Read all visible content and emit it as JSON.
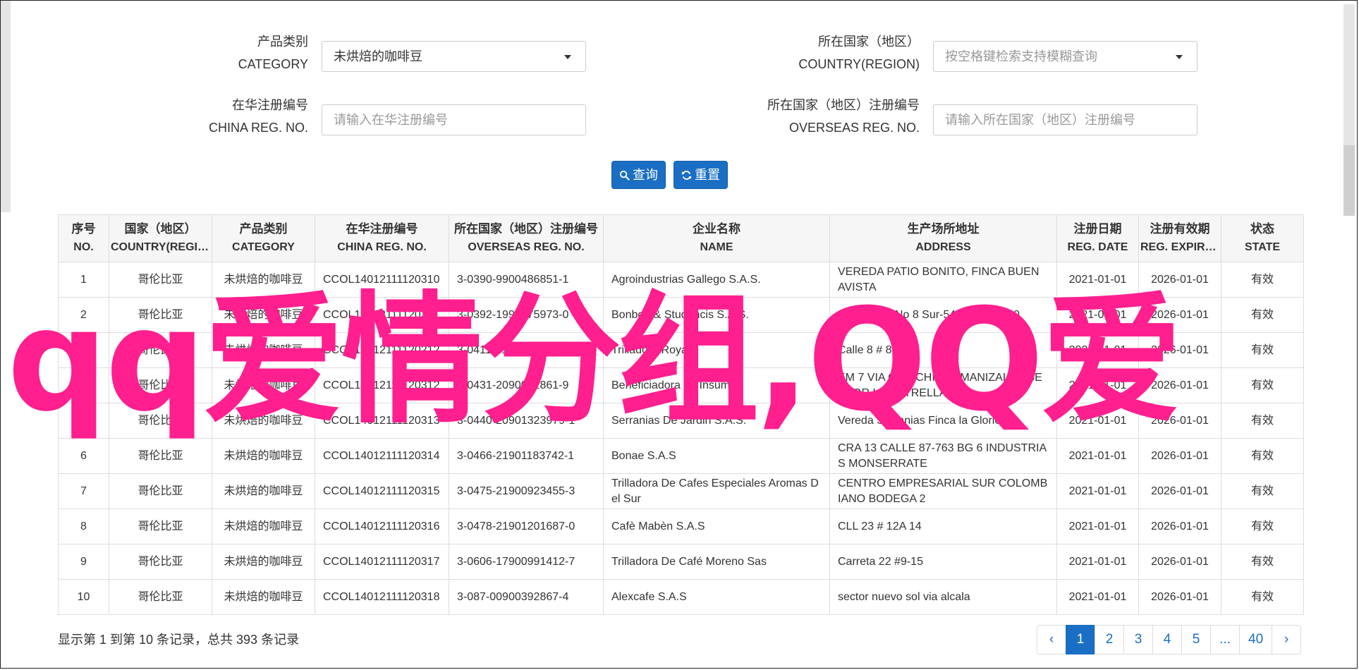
{
  "search": {
    "category_label_cn": "产品类别",
    "category_label_en": "CATEGORY",
    "category_value": "未烘焙的咖啡豆",
    "country_label_cn": "所在国家（地区）",
    "country_label_en": "COUNTRY(REGION)",
    "country_placeholder": "按空格键检索支持模糊查询",
    "china_reg_label_cn": "在华注册编号",
    "china_reg_label_en": "CHINA REG. NO.",
    "china_reg_placeholder": "请输入在华注册编号",
    "overseas_reg_label_cn": "所在国家（地区）注册编号",
    "overseas_reg_label_en": "OVERSEAS REG. NO.",
    "overseas_reg_placeholder": "请输入所在国家（地区）注册编号",
    "query_button": "查询",
    "reset_button": "重置"
  },
  "table": {
    "headers": [
      {
        "cn": "序号",
        "en": "NO."
      },
      {
        "cn": "国家（地区）",
        "en": "COUNTRY(REGIO..."
      },
      {
        "cn": "产品类别",
        "en": "CATEGORY"
      },
      {
        "cn": "在华注册编号",
        "en": "CHINA REG. NO."
      },
      {
        "cn": "所在国家（地区）注册编号",
        "en": "OVERSEAS REG. NO."
      },
      {
        "cn": "企业名称",
        "en": "NAME"
      },
      {
        "cn": "生产场所地址",
        "en": "ADDRESS"
      },
      {
        "cn": "注册日期",
        "en": "REG. DATE"
      },
      {
        "cn": "注册有效期",
        "en": "REG. EXPIRE ..."
      },
      {
        "cn": "状态",
        "en": "STATE"
      }
    ],
    "rows": [
      [
        "1",
        "哥伦比亚",
        "未烘焙的咖啡豆",
        "CCOL14012111120310",
        "3-0390-9900486851-1",
        "Agroindustrias Gallego S.A.S.",
        "VEREDA PATIO BONITO, FINCA BUEN AVISTA",
        "2021-01-01",
        "2026-01-01",
        "有效"
      ],
      [
        "2",
        "哥伦比亚",
        "未烘焙的咖啡豆",
        "CCOL14012111120311",
        "3-0392-1990075973-0",
        "Bonbori & Studancis S.A.S.",
        "Carrera 49 No 8 Sur-540 Bodega 20",
        "2021-01-01",
        "2026-01-01",
        "有效"
      ],
      [
        "3",
        "哥伦比亚",
        "未烘焙的咖啡豆",
        "CCOL14012111120212",
        "3-0411-2190009812-1",
        "Trilladora Royal",
        "Calle 8 # 8 - 28",
        "2021-01-01",
        "2026-01-01",
        "有效"
      ],
      [
        "4",
        "哥伦比亚",
        "未烘焙的咖啡豆",
        "CCOL14012111120312",
        "3-0431-2090021861-9",
        "Beneficiadora de Insumos",
        "KM 7 VIA CHINCHINA - MANIZALES SECTOR LA ESTRELLA",
        "2021-01-01",
        "2026-01-01",
        "有效"
      ],
      [
        "5",
        "哥伦比亚",
        "未烘焙的咖啡豆",
        "CCOL14012111120313",
        "3-0440-20901323979-1",
        "Serranias De Jardin S.A.S.",
        "Vereda Serranias Finca la Glorieta",
        "2021-01-01",
        "2026-01-01",
        "有效"
      ],
      [
        "6",
        "哥伦比亚",
        "未烘焙的咖啡豆",
        "CCOL14012111120314",
        "3-0466-21901183742-1",
        "Bonae S.A.S",
        "CRA 13 CALLE 87-763 BG 6 INDUSTRIAS MONSERRATE",
        "2021-01-01",
        "2026-01-01",
        "有效"
      ],
      [
        "7",
        "哥伦比亚",
        "未烘焙的咖啡豆",
        "CCOL14012111120315",
        "3-0475-21900923455-3",
        "Trilladora De Cafes Especiales Aromas Del Sur",
        "CENTRO EMPRESARIAL SUR COLOMBIANO BODEGA 2",
        "2021-01-01",
        "2026-01-01",
        "有效"
      ],
      [
        "8",
        "哥伦比亚",
        "未烘焙的咖啡豆",
        "CCOL14012111120316",
        "3-0478-21901201687-0",
        "Cafè Mabèn S.A.S",
        "CLL 23 # 12A 14",
        "2021-01-01",
        "2026-01-01",
        "有效"
      ],
      [
        "9",
        "哥伦比亚",
        "未烘焙的咖啡豆",
        "CCOL14012111120317",
        "3-0606-17900991412-7",
        "Trilladora De Café Moreno Sas",
        "Carreta 22 #9-15",
        "2021-01-01",
        "2026-01-01",
        "有效"
      ],
      [
        "10",
        "哥伦比亚",
        "未烘焙的咖啡豆",
        "CCOL14012111120318",
        "3-087-00900392867-4",
        "Alexcafe S.A.S",
        "sector nuevo sol via alcala",
        "2021-01-01",
        "2026-01-01",
        "有效"
      ]
    ]
  },
  "footer": {
    "summary": "显示第 1 到第 10 条记录，总共 393 条记录",
    "pages": [
      "‹",
      "1",
      "2",
      "3",
      "4",
      "5",
      "...",
      "40",
      "›"
    ],
    "active_page": "1"
  },
  "overlay": {
    "text": "qq爱情分组,QQ爱"
  },
  "colors": {
    "primary": "#1a6fc4",
    "overlay": "#ff1f8e"
  }
}
